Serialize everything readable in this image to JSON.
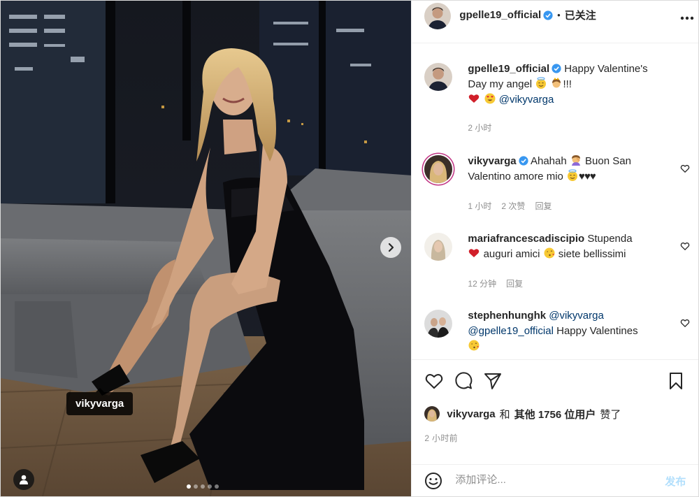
{
  "header": {
    "username": "gpelle19_official",
    "separator": "•",
    "follow_status": "已关注",
    "more_icon": "more-horizontal-icon"
  },
  "photo": {
    "tag_label": "vikyvarga",
    "carousel_count": 5,
    "carousel_active": 1,
    "next_icon": "chevron-right-icon",
    "user_tag_icon": "person-icon"
  },
  "caption": {
    "username": "gpelle19_official",
    "text_1": "Happy Valentine's",
    "text_2": "Day my angel",
    "text_3": "!!!",
    "mention": "@vikyvarga",
    "time": "2 小时"
  },
  "comments": [
    {
      "username": "vikyvarga",
      "text_1": "Ahahah",
      "text_2": "Buon San",
      "text_3": "Valentino amore mio",
      "text_4": "♥♥♥",
      "time": "1 小时",
      "likes": "2 次赞",
      "reply": "回复"
    },
    {
      "username": "mariafrancescadiscipio",
      "text_1": "Stupenda",
      "text_2": "auguri amici",
      "text_3": "siete bellissimi",
      "time": "12 分钟",
      "reply": "回复"
    },
    {
      "username": "stephenhunghk",
      "mention_1": "@vikyvarga",
      "mention_2": "@gpelle19_official",
      "text_1": "Happy Valentines"
    }
  ],
  "likes": {
    "username": "vikyvarga",
    "conj": "和",
    "others": "其他 1756 位用户",
    "suffix": "赞了"
  },
  "post_time": "2 小时前",
  "add_comment": {
    "placeholder": "添加评论...",
    "post_label": "发布"
  },
  "colors": {
    "verified": "#3897f0",
    "heart": "#ed4956",
    "post_button": "#b2dffc",
    "muted_text": "#8e8e8e"
  }
}
